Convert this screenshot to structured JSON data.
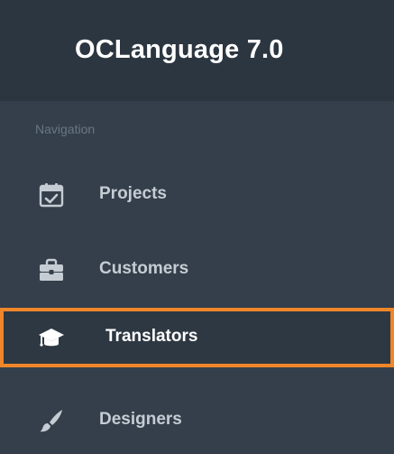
{
  "brand": {
    "title": "OCLanguage 7.0"
  },
  "navigation": {
    "heading": "Navigation",
    "items": [
      {
        "label": "Projects",
        "icon": "calendar-check-icon",
        "active": false
      },
      {
        "label": "Customers",
        "icon": "briefcase-icon",
        "active": false
      },
      {
        "label": "Translators",
        "icon": "graduation-cap-icon",
        "active": true
      },
      {
        "label": "Designers",
        "icon": "paintbrush-icon",
        "active": false
      }
    ]
  },
  "colors": {
    "sidebar_bg": "#343f4b",
    "header_bg": "#2c3641",
    "active_border": "#f0862a",
    "item_text": "#c5ccd3",
    "active_text": "#ffffff",
    "heading_text": "#6a7683"
  }
}
